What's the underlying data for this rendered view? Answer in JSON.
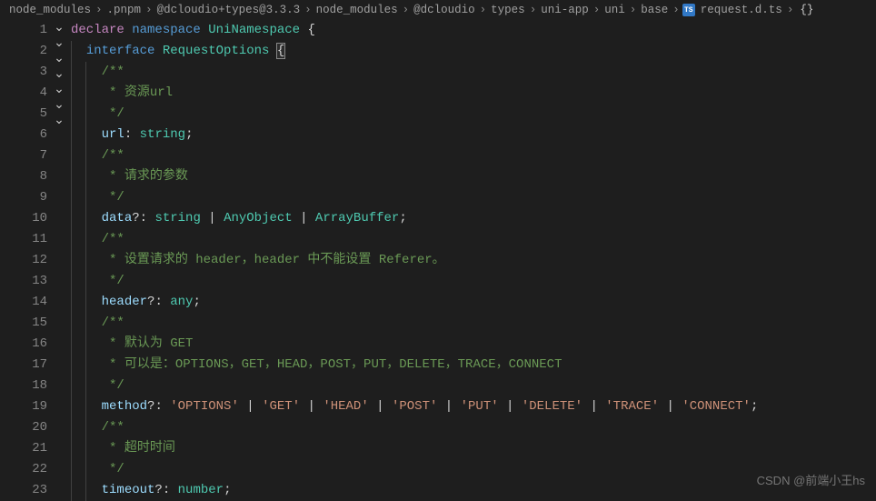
{
  "breadcrumb": {
    "segments": [
      "node_modules",
      ".pnpm",
      "@dcloudio+types@3.3.3",
      "node_modules",
      "@dcloudio",
      "types",
      "uni-app",
      "uni",
      "base"
    ],
    "file": "request.d.ts",
    "symbol": "{}"
  },
  "lines": {
    "1": {
      "num": "1",
      "fold": true,
      "tokens": [
        {
          "t": "declare",
          "c": "kw-declare"
        },
        {
          "t": " ",
          "c": ""
        },
        {
          "t": "namespace",
          "c": "kw-namespace"
        },
        {
          "t": " ",
          "c": ""
        },
        {
          "t": "UniNamespace",
          "c": "type-name"
        },
        {
          "t": " ",
          "c": ""
        },
        {
          "t": "{",
          "c": "punct"
        }
      ],
      "indent": 0
    },
    "2": {
      "num": "2",
      "fold": true,
      "tokens": [
        {
          "t": "interface",
          "c": "kw-interface"
        },
        {
          "t": " ",
          "c": ""
        },
        {
          "t": "RequestOptions",
          "c": "type-name"
        },
        {
          "t": " ",
          "c": ""
        },
        {
          "t": "{",
          "c": "punct hl-brace"
        }
      ],
      "indent": 1
    },
    "3": {
      "num": "3",
      "fold": true,
      "tokens": [
        {
          "t": "/**",
          "c": "comment"
        }
      ],
      "indent": 2
    },
    "4": {
      "num": "4",
      "tokens": [
        {
          "t": " * 资源url",
          "c": "comment"
        }
      ],
      "indent": 2
    },
    "5": {
      "num": "5",
      "tokens": [
        {
          "t": " */",
          "c": "comment"
        }
      ],
      "indent": 2
    },
    "6": {
      "num": "6",
      "tokens": [
        {
          "t": "url",
          "c": "prop"
        },
        {
          "t": ": ",
          "c": "punct"
        },
        {
          "t": "string",
          "c": "type-prim"
        },
        {
          "t": ";",
          "c": "punct"
        }
      ],
      "indent": 2
    },
    "7": {
      "num": "7",
      "fold": true,
      "tokens": [
        {
          "t": "/**",
          "c": "comment"
        }
      ],
      "indent": 2
    },
    "8": {
      "num": "8",
      "tokens": [
        {
          "t": " * 请求的参数",
          "c": "comment"
        }
      ],
      "indent": 2
    },
    "9": {
      "num": "9",
      "tokens": [
        {
          "t": " */",
          "c": "comment"
        }
      ],
      "indent": 2
    },
    "10": {
      "num": "10",
      "tokens": [
        {
          "t": "data",
          "c": "prop"
        },
        {
          "t": "?",
          "c": "optional"
        },
        {
          "t": ": ",
          "c": "punct"
        },
        {
          "t": "string",
          "c": "type-prim"
        },
        {
          "t": " | ",
          "c": "pipe"
        },
        {
          "t": "AnyObject",
          "c": "type-ref"
        },
        {
          "t": " | ",
          "c": "pipe"
        },
        {
          "t": "ArrayBuffer",
          "c": "type-ref"
        },
        {
          "t": ";",
          "c": "punct"
        }
      ],
      "indent": 2
    },
    "11": {
      "num": "11",
      "fold": true,
      "tokens": [
        {
          "t": "/**",
          "c": "comment"
        }
      ],
      "indent": 2
    },
    "12": {
      "num": "12",
      "tokens": [
        {
          "t": " * 设置请求的 header，header 中不能设置 Referer。",
          "c": "comment"
        }
      ],
      "indent": 2
    },
    "13": {
      "num": "13",
      "tokens": [
        {
          "t": " */",
          "c": "comment"
        }
      ],
      "indent": 2
    },
    "14": {
      "num": "14",
      "tokens": [
        {
          "t": "header",
          "c": "prop"
        },
        {
          "t": "?",
          "c": "optional"
        },
        {
          "t": ": ",
          "c": "punct"
        },
        {
          "t": "any",
          "c": "type-prim"
        },
        {
          "t": ";",
          "c": "punct"
        }
      ],
      "indent": 2
    },
    "15": {
      "num": "15",
      "fold": true,
      "tokens": [
        {
          "t": "/**",
          "c": "comment"
        }
      ],
      "indent": 2
    },
    "16": {
      "num": "16",
      "tokens": [
        {
          "t": " * 默认为 GET",
          "c": "comment"
        }
      ],
      "indent": 2
    },
    "17": {
      "num": "17",
      "tokens": [
        {
          "t": " * 可以是：OPTIONS，GET，HEAD，POST，PUT，DELETE，TRACE，CONNECT",
          "c": "comment"
        }
      ],
      "indent": 2
    },
    "18": {
      "num": "18",
      "tokens": [
        {
          "t": " */",
          "c": "comment"
        }
      ],
      "indent": 2
    },
    "19": {
      "num": "19",
      "tokens": [
        {
          "t": "method",
          "c": "prop"
        },
        {
          "t": "?",
          "c": "optional"
        },
        {
          "t": ": ",
          "c": "punct"
        },
        {
          "t": "'OPTIONS'",
          "c": "str"
        },
        {
          "t": " | ",
          "c": "pipe"
        },
        {
          "t": "'GET'",
          "c": "str"
        },
        {
          "t": " | ",
          "c": "pipe"
        },
        {
          "t": "'HEAD'",
          "c": "str"
        },
        {
          "t": " | ",
          "c": "pipe"
        },
        {
          "t": "'POST'",
          "c": "str"
        },
        {
          "t": " | ",
          "c": "pipe"
        },
        {
          "t": "'PUT'",
          "c": "str"
        },
        {
          "t": " | ",
          "c": "pipe"
        },
        {
          "t": "'DELETE'",
          "c": "str"
        },
        {
          "t": " | ",
          "c": "pipe"
        },
        {
          "t": "'TRACE'",
          "c": "str"
        },
        {
          "t": " | ",
          "c": "pipe"
        },
        {
          "t": "'CONNECT'",
          "c": "str"
        },
        {
          "t": ";",
          "c": "punct"
        }
      ],
      "indent": 2
    },
    "20": {
      "num": "20",
      "fold": true,
      "tokens": [
        {
          "t": "/**",
          "c": "comment"
        }
      ],
      "indent": 2
    },
    "21": {
      "num": "21",
      "tokens": [
        {
          "t": " * 超时时间",
          "c": "comment"
        }
      ],
      "indent": 2
    },
    "22": {
      "num": "22",
      "tokens": [
        {
          "t": " */",
          "c": "comment"
        }
      ],
      "indent": 2
    },
    "23": {
      "num": "23",
      "tokens": [
        {
          "t": "timeout",
          "c": "prop"
        },
        {
          "t": "?",
          "c": "optional"
        },
        {
          "t": ": ",
          "c": "punct"
        },
        {
          "t": "number",
          "c": "type-prim"
        },
        {
          "t": ";",
          "c": "punct"
        }
      ],
      "indent": 2
    }
  },
  "watermark": "CSDN @前端小王hs",
  "icons": {
    "chevron": "›",
    "foldOpen": "⌄"
  }
}
